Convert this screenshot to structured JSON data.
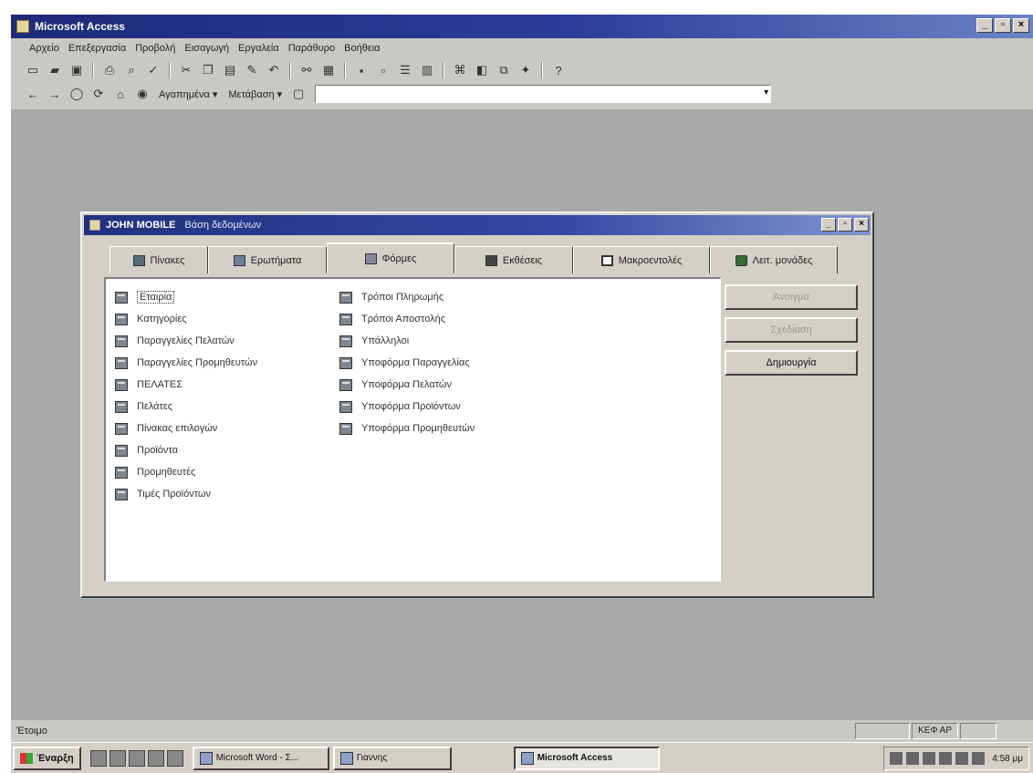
{
  "app": {
    "title": "Microsoft Access"
  },
  "menu": [
    "Αρχείο",
    "Επεξεργασία",
    "Προβολή",
    "Εισαγωγή",
    "Εργαλεία",
    "Παράθυρο",
    "Βοήθεια"
  ],
  "toolbar2": {
    "favorites_label": "Αγαπημένα ▾",
    "goto_label": "Μετάβαση ▾"
  },
  "db_window": {
    "name": "JOHN MOBILE",
    "subtitle": "Βάση δεδομένων",
    "tabs": [
      {
        "label": "Πίνακες",
        "icon": "table-icon"
      },
      {
        "label": "Ερωτήματα",
        "icon": "query-icon"
      },
      {
        "label": "Φόρμες",
        "icon": "form-icon",
        "active": true
      },
      {
        "label": "Εκθέσεις",
        "icon": "report-icon"
      },
      {
        "label": "Μακροεντολές",
        "icon": "macro-icon"
      },
      {
        "label": "Λειτ. μονάδες",
        "icon": "module-icon"
      }
    ],
    "forms_col1": [
      "Εταιρία",
      "Κατηγορίες",
      "Παραγγελίες Πελατών",
      "Παραγγελίες Προμηθευτών",
      "ΠΕΛΑΤΕΣ",
      "Πελάτες",
      "Πίνακας επιλογών",
      "Προϊόντα",
      "Προμηθευτές",
      "Τιμές Προϊόντων"
    ],
    "forms_col2": [
      "Τρόποι Πληρωμής",
      "Τρόποι Αποστολής",
      "Υπάλληλοι",
      "Υποφόρμα Παραγγελίας",
      "Υποφόρμα Πελατών",
      "Υποφόρμα Προϊόντων",
      "Υποφόρμα Προμηθευτών"
    ],
    "buttons": {
      "open": "Άνοιγμα",
      "design": "Σχεδίαση",
      "new": "Δημιουργία"
    }
  },
  "statusbar": {
    "text": "Έτοιμο",
    "pane_num": "ΚΕΦ ΑΡ"
  },
  "taskbar": {
    "start": "Έναρξη",
    "tasks": [
      "Microsoft Word - Σ...",
      "Γιαννης",
      "Microsoft Access"
    ],
    "clock": "4:58 μμ"
  }
}
